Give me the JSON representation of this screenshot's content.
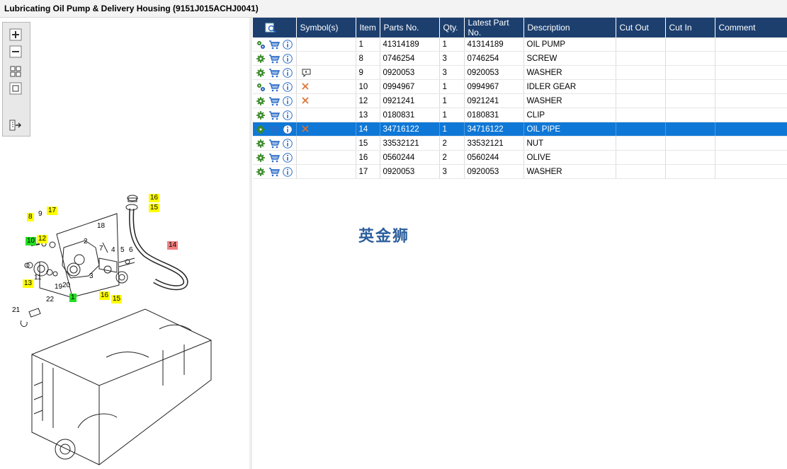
{
  "window": {
    "title": "Lubricating Oil Pump & Delivery Housing (9151J015ACHJ0041)"
  },
  "toolbox": {
    "zoom_in": "zoom-in-icon",
    "zoom_out": "zoom-out-icon",
    "fit": "fit-all-icon",
    "actual": "actual-size-icon",
    "export": "export-icon"
  },
  "table": {
    "headers": [
      "",
      "Symbol(s)",
      "Item",
      "Parts No.",
      "Qty.",
      "Latest Part No.",
      "Description",
      "Cut Out",
      "Cut In",
      "Comment"
    ],
    "rows": [
      {
        "icon_set": "gears",
        "symbol": "",
        "item": "1",
        "part": "41314189",
        "qty": "1",
        "latest": "41314189",
        "desc": "OIL PUMP",
        "cut_out": "",
        "cut_in": "",
        "comment": ""
      },
      {
        "icon_set": "gear",
        "symbol": "",
        "item": "8",
        "part": "0746254",
        "qty": "3",
        "latest": "0746254",
        "desc": "SCREW",
        "cut_out": "",
        "cut_in": "",
        "comment": ""
      },
      {
        "icon_set": "gear",
        "symbol": "note",
        "item": "9",
        "part": "0920053",
        "qty": "3",
        "latest": "0920053",
        "desc": "WASHER",
        "cut_out": "",
        "cut_in": "",
        "comment": ""
      },
      {
        "icon_set": "gears",
        "symbol": "cross",
        "item": "10",
        "part": "0994967",
        "qty": "1",
        "latest": "0994967",
        "desc": "IDLER GEAR",
        "cut_out": "",
        "cut_in": "",
        "comment": ""
      },
      {
        "icon_set": "gear",
        "symbol": "cross",
        "item": "12",
        "part": "0921241",
        "qty": "1",
        "latest": "0921241",
        "desc": "WASHER",
        "cut_out": "",
        "cut_in": "",
        "comment": ""
      },
      {
        "icon_set": "gear",
        "symbol": "",
        "item": "13",
        "part": "0180831",
        "qty": "1",
        "latest": "0180831",
        "desc": "CLIP",
        "cut_out": "",
        "cut_in": "",
        "comment": ""
      },
      {
        "icon_set": "gear",
        "symbol": "cross",
        "item": "14",
        "part": "34716122",
        "qty": "1",
        "latest": "34716122",
        "desc": "OIL PIPE",
        "cut_out": "",
        "cut_in": "",
        "comment": "",
        "selected": true
      },
      {
        "icon_set": "gear",
        "symbol": "",
        "item": "15",
        "part": "33532121",
        "qty": "2",
        "latest": "33532121",
        "desc": "NUT",
        "cut_out": "",
        "cut_in": "",
        "comment": ""
      },
      {
        "icon_set": "gear",
        "symbol": "",
        "item": "16",
        "part": "0560244",
        "qty": "2",
        "latest": "0560244",
        "desc": "OLIVE",
        "cut_out": "",
        "cut_in": "",
        "comment": ""
      },
      {
        "icon_set": "gear",
        "symbol": "",
        "item": "17",
        "part": "0920053",
        "qty": "3",
        "latest": "0920053",
        "desc": "WASHER",
        "cut_out": "",
        "cut_in": "",
        "comment": ""
      }
    ]
  },
  "watermark": "英金狮",
  "diagram": {
    "callouts": [
      {
        "label": "16",
        "style": "yl"
      },
      {
        "label": "15",
        "style": "yl"
      },
      {
        "label": "8",
        "style": "yl"
      },
      {
        "label": "9",
        "style": "plain"
      },
      {
        "label": "17",
        "style": "yl"
      },
      {
        "label": "18",
        "style": "plain"
      },
      {
        "label": "14",
        "style": "pk"
      },
      {
        "label": "10",
        "style": "gr"
      },
      {
        "label": "12",
        "style": "yl"
      },
      {
        "label": "2",
        "style": "plain"
      },
      {
        "label": "7",
        "style": "plain"
      },
      {
        "label": "4",
        "style": "plain"
      },
      {
        "label": "5",
        "style": "plain"
      },
      {
        "label": "6",
        "style": "plain"
      },
      {
        "label": "11",
        "style": "plain"
      },
      {
        "label": "3",
        "style": "plain"
      },
      {
        "label": "13",
        "style": "yl"
      },
      {
        "label": "19",
        "style": "plain"
      },
      {
        "label": "20",
        "style": "plain"
      },
      {
        "label": "16",
        "style": "yl"
      },
      {
        "label": "15",
        "style": "yl"
      },
      {
        "label": "1",
        "style": "gr"
      },
      {
        "label": "22",
        "style": "plain"
      },
      {
        "label": "21",
        "style": "plain"
      }
    ]
  }
}
